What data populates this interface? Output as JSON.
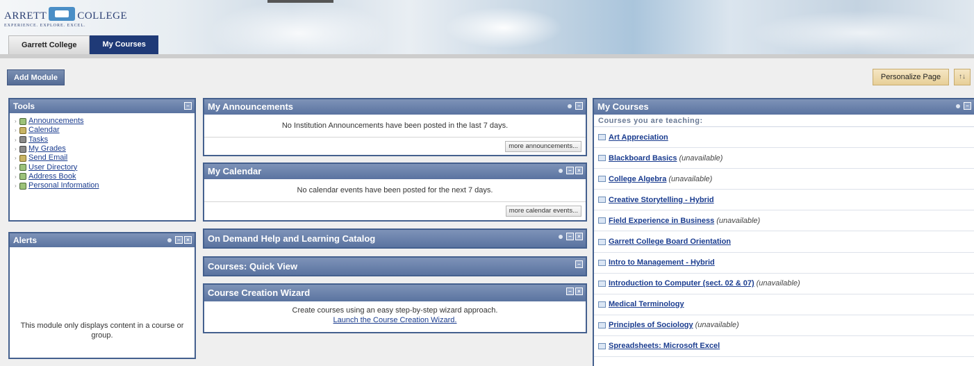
{
  "header": {
    "logo_left": "ARRETT",
    "logo_right": "COLLEGE",
    "tagline": "EXPERIENCE. EXPLORE. EXCEL.",
    "tabs": [
      {
        "label": "Garrett College",
        "active": false
      },
      {
        "label": "My Courses",
        "active": true
      }
    ]
  },
  "toolbar": {
    "add_module": "Add Module",
    "personalize": "Personalize Page",
    "sort": "↑↓"
  },
  "tools": {
    "title": "Tools",
    "items": [
      "Announcements",
      "Calendar",
      "Tasks",
      "My Grades",
      "Send Email",
      "User Directory",
      "Address Book",
      "Personal Information"
    ]
  },
  "alerts": {
    "title": "Alerts",
    "message": "This module only displays content in a course or group."
  },
  "announcements": {
    "title": "My Announcements",
    "message": "No Institution Announcements have been posted in the last 7 days.",
    "more": "more announcements..."
  },
  "calendar": {
    "title": "My Calendar",
    "message": "No calendar events have been posted for the next 7 days.",
    "more": "more calendar events..."
  },
  "ondemand": {
    "title": "On Demand Help and Learning Catalog"
  },
  "quickview": {
    "title": "Courses: Quick View"
  },
  "wizard": {
    "title": "Course Creation Wizard",
    "text": "Create courses using an easy step-by-step wizard approach.",
    "link": "Launch the Course Creation Wizard."
  },
  "my_courses": {
    "title": "My Courses",
    "subheading": "Courses you are teaching:",
    "courses": [
      {
        "name": "Art Appreciation",
        "status": ""
      },
      {
        "name": "Blackboard Basics",
        "status": "(unavailable)"
      },
      {
        "name": "College Algebra",
        "status": "(unavailable)"
      },
      {
        "name": "Creative Storytelling - Hybrid",
        "status": ""
      },
      {
        "name": "Field Experience in Business",
        "status": "(unavailable)"
      },
      {
        "name": "Garrett College Board Orientation",
        "status": ""
      },
      {
        "name": "Intro to Management - Hybrid",
        "status": ""
      },
      {
        "name": "Introduction to Computer (sect. 02 & 07)",
        "status": "(unavailable)"
      },
      {
        "name": "Medical Terminology",
        "status": ""
      },
      {
        "name": "Principles of Sociology",
        "status": "(unavailable)"
      },
      {
        "name": "Spreadsheets: Microsoft Excel",
        "status": ""
      }
    ]
  }
}
